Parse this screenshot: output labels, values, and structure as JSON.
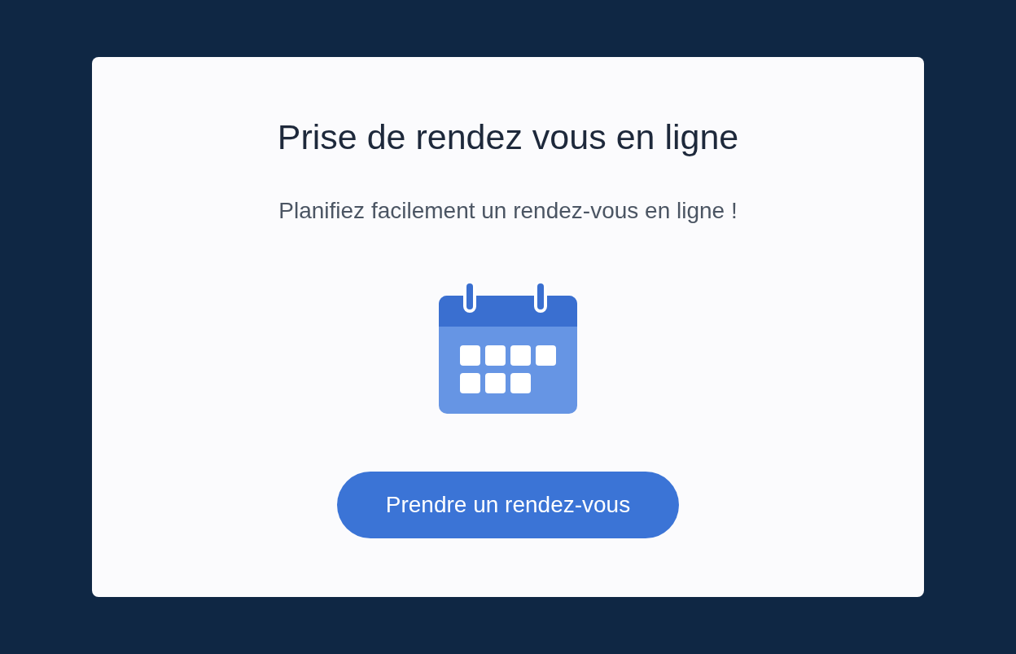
{
  "card": {
    "title": "Prise de rendez vous en ligne",
    "subtitle": "Planifiez facilement un rendez-vous en ligne !",
    "button": "Prendre un rendez-vous"
  }
}
